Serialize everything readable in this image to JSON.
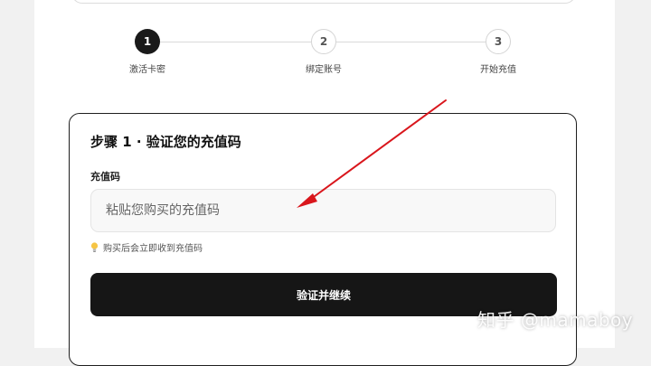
{
  "stepper": {
    "steps": [
      {
        "number": "1",
        "label": "激活卡密"
      },
      {
        "number": "2",
        "label": "绑定账号"
      },
      {
        "number": "3",
        "label": "开始充值"
      }
    ]
  },
  "card": {
    "title": "步骤 1 · 验证您的充值码",
    "field_label": "充值码",
    "input_placeholder": "粘贴您购买的充值码",
    "input_value": "",
    "hint": "购买后会立即收到充值码",
    "submit_label": "验证并继续"
  },
  "watermark": "知乎 @mamaboy",
  "colors": {
    "accent": "#161616",
    "annotation_arrow": "#d9161c"
  },
  "icons": {
    "hint_icon": "lightbulb-icon"
  }
}
